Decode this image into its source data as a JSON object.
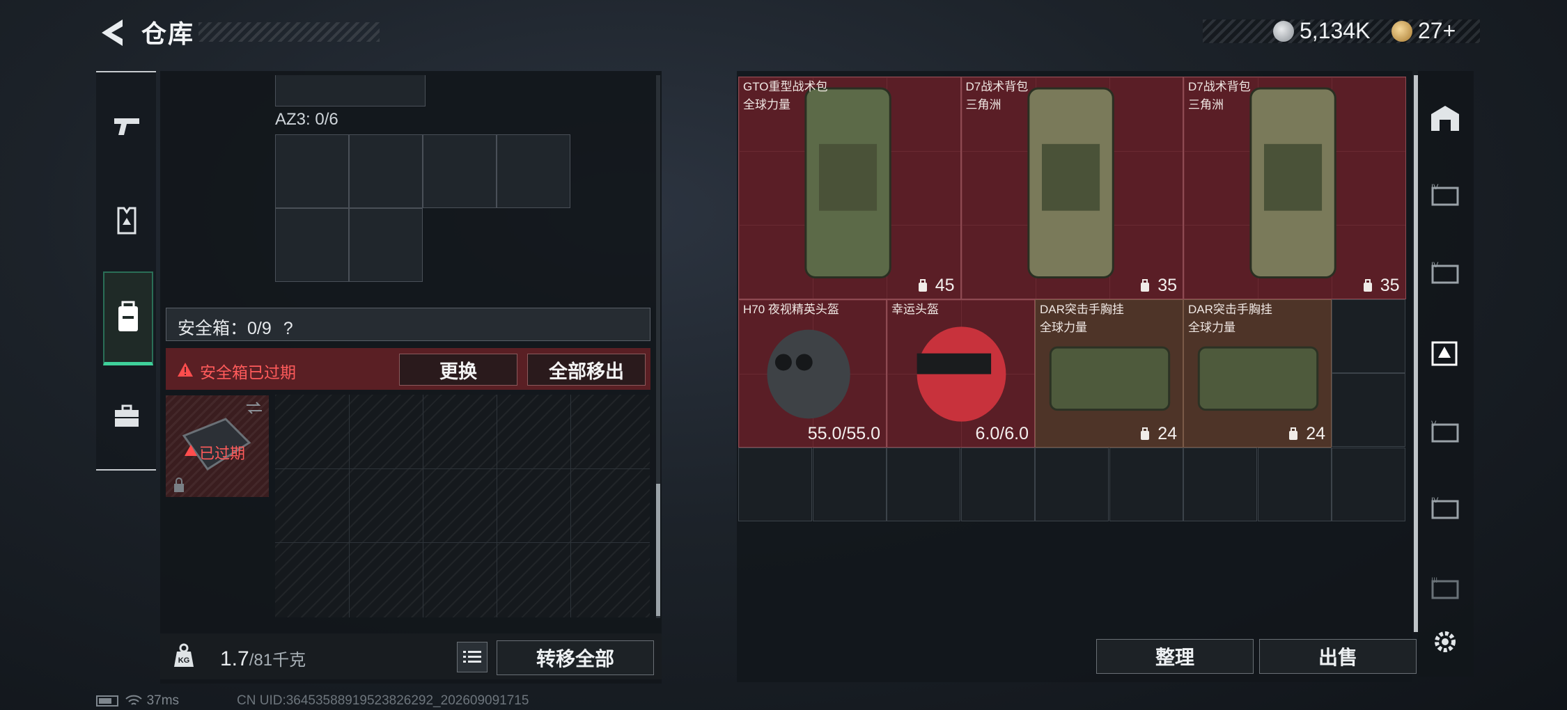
{
  "header": {
    "title": "仓库",
    "currency_1": "5,134K",
    "currency_2": "27+"
  },
  "left_panel": {
    "container_label": "AZ3: 0/6",
    "safebox_label": "安全箱：0/9",
    "help_mark": "?",
    "expired_message": "安全箱已过期",
    "replace_button": "更换",
    "move_all_button": "全部移出",
    "thumb_expired": "已过期",
    "weight_current": "1.7",
    "weight_max": "/81千克",
    "transfer_all_button": "转移全部"
  },
  "inventory": {
    "items": [
      {
        "name": "GTO重型战术包",
        "sub": "全球力量",
        "stat": "45",
        "stat_icon": "backpack-capacity-icon",
        "color": "red"
      },
      {
        "name": "D7战术背包",
        "sub": "三角洲",
        "stat": "35",
        "stat_icon": "backpack-capacity-icon",
        "color": "red"
      },
      {
        "name": "D7战术背包",
        "sub": "三角洲",
        "stat": "35",
        "stat_icon": "backpack-capacity-icon",
        "color": "red"
      },
      {
        "name": "H70 夜视精英头盔",
        "sub": "",
        "stat": "55.0/55.0",
        "stat_icon": "",
        "color": "red"
      },
      {
        "name": "幸运头盔",
        "sub": "",
        "stat": "6.0/6.0",
        "stat_icon": "",
        "color": "red"
      },
      {
        "name": "DAR突击手胸挂",
        "sub": "全球力量",
        "stat": "24",
        "stat_icon": "vest-capacity-icon",
        "color": "brown"
      },
      {
        "name": "DAR突击手胸挂",
        "sub": "全球力量",
        "stat": "24",
        "stat_icon": "vest-capacity-icon",
        "color": "brown"
      }
    ],
    "sort_button": "整理",
    "sell_button": "出售"
  },
  "status": {
    "ping": "37ms",
    "uid": "CN UID:36453588919523826292_202609091715"
  },
  "colors": {
    "accent_green": "#3fd19b",
    "rare_red": "#5a1e26",
    "brown": "#4e3428",
    "warning_red": "#ff5b5b"
  }
}
